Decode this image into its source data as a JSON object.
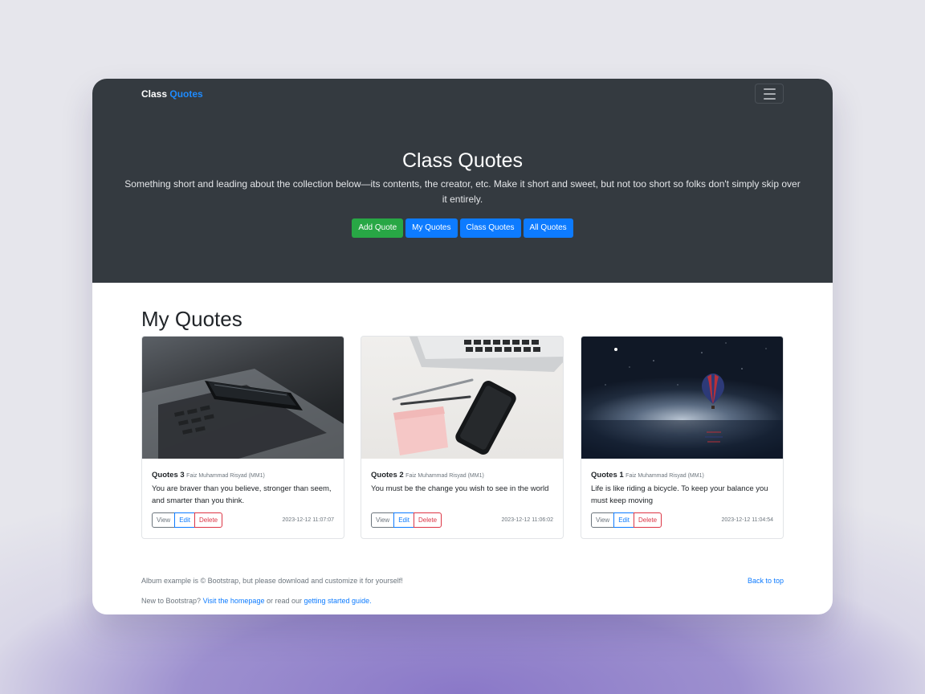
{
  "navbar": {
    "brand_part1": "Class",
    "brand_part2": "Quotes"
  },
  "hero": {
    "title": "Class Quotes",
    "lead": "Something short and leading about the collection below—its contents, the creator, etc. Make it short and sweet, but not too short so folks don't simply skip over it entirely.",
    "buttons": {
      "add": "Add Quote",
      "mine": "My Quotes",
      "class": "Class Quotes",
      "all": "All Quotes"
    }
  },
  "section": {
    "title": "My Quotes"
  },
  "cards": [
    {
      "title": "Quotes 3",
      "author": "Faiz Muhammad Risyad (MM1)",
      "text": "You are braver than you believe, stronger than seem, and smarter than you think.",
      "timestamp": "2023-12-12 11:07:07"
    },
    {
      "title": "Quotes 2",
      "author": "Faiz Muhammad Risyad (MM1)",
      "text": "You must be the change you wish to see in the world",
      "timestamp": "2023-12-12 11:06:02"
    },
    {
      "title": "Quotes 1",
      "author": "Faiz Muhammad Risyad (MM1)",
      "text": "Life is like riding a bicycle. To keep your balance you must keep moving",
      "timestamp": "2023-12-12 11:04:54"
    }
  ],
  "card_buttons": {
    "view": "View",
    "edit": "Edit",
    "delete": "Delete"
  },
  "footer": {
    "line1": "Album example is © Bootstrap, but please download and customize it for yourself!",
    "back_to_top": "Back to top",
    "line2_prefix": "New to Bootstrap?",
    "homepage_link": "Visit the homepage",
    "line2_middle": "or read our",
    "guide_link": "getting started guide."
  },
  "colors": {
    "hero_bg": "#343a40",
    "primary": "#0d7bff",
    "success": "#28a745",
    "danger": "#dc3545",
    "secondary": "#6c757d"
  },
  "icons": {
    "toggler": "hamburger-menu-icon"
  }
}
